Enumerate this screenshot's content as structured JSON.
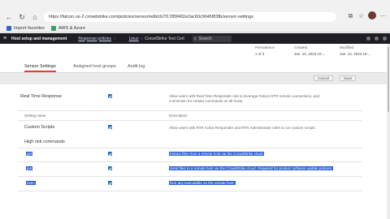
{
  "browser": {
    "url": "https://falcon.us-2.crowdstrike.com/policies/sensor/edit/cb7f1785f482e2ac60c9645f83fb/sensor-settings",
    "bookmarks": [
      "Import favorites",
      "AWS & Azure"
    ]
  },
  "appbar": {
    "brand": "Host setup and management",
    "crumbs": [
      "Response policies",
      "Linux",
      "CrowdStrike Test Cert"
    ],
    "search_placeholder": "Search"
  },
  "meta": {
    "precedence_label": "Precedence",
    "precedence_value": "1 of 3",
    "created_label": "Created",
    "created_value": "Jan. 10, 2023 10:...",
    "modified_label": "Modified",
    "modified_value": "Jan. 12, 2023 15:..."
  },
  "tabs": [
    "Sensor Settings",
    "Assigned host groups",
    "Audit log"
  ],
  "actions": {
    "cancel": "Cancel",
    "save": "Save"
  },
  "rtr": {
    "label": "Real Time Response",
    "description": "Allow users with Real Time Responder role to leverage Falcon RTR remote connections, and connection for certain commands on all hosts."
  },
  "columns": {
    "setting": "Setting name",
    "description": "Description"
  },
  "custom_scripts": {
    "label": "Custom Scripts",
    "description": "Allow users with RTR Active Responder and RTR Administrator roles to run custom scripts."
  },
  "high_risk": {
    "label": "High risk commands",
    "commands": [
      {
        "name": "get",
        "description": "Extract files from a remote host via the CrowdStrike cloud"
      },
      {
        "name": "put",
        "description": "Send files to a remote host via the CrowdStrike cloud. Required for product software update policies."
      },
      {
        "name": "exec",
        "description": "Run any executable on the remote host."
      }
    ]
  }
}
